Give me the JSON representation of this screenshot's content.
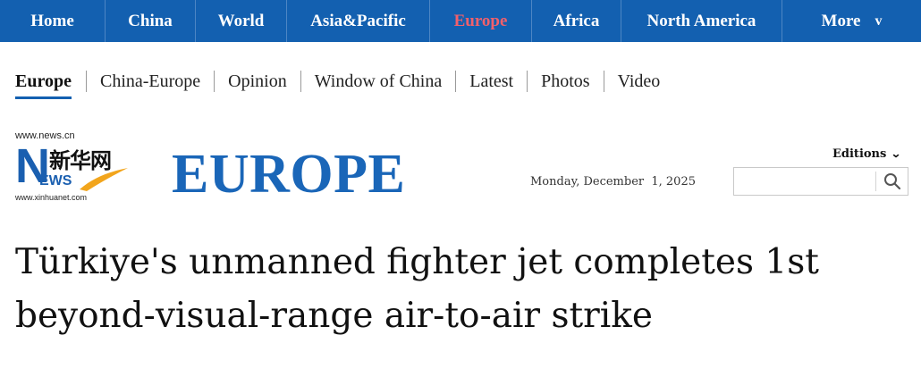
{
  "topnav": {
    "items": [
      {
        "label": "Home"
      },
      {
        "label": "China"
      },
      {
        "label": "World"
      },
      {
        "label": "Asia&Pacific"
      },
      {
        "label": "Europe",
        "active": true
      },
      {
        "label": "Africa"
      },
      {
        "label": "North America"
      },
      {
        "label": "More",
        "icon": "chevron-down-icon",
        "chevron": "v"
      }
    ],
    "bg_color": "#1360b0",
    "active_color": "#f2606b"
  },
  "subnav": {
    "items": [
      {
        "label": "Europe",
        "active": true
      },
      {
        "label": "China-Europe"
      },
      {
        "label": "Opinion"
      },
      {
        "label": "Window of China"
      },
      {
        "label": "Latest"
      },
      {
        "label": "Photos"
      },
      {
        "label": "Video"
      }
    ]
  },
  "logo": {
    "url_top": "www.news.cn",
    "letter": "N",
    "chinese": "新华网",
    "ews": "EWS",
    "url_bottom": "www.xinhuanet.com",
    "brand_color": "#1a5fb0",
    "swoosh_color": "#f2a51c"
  },
  "section_title": "EUROPE",
  "date": "Monday, December  1, 2025",
  "editions": {
    "label": "Editions",
    "icon": "chevron-down-icon"
  },
  "search": {
    "placeholder": "",
    "value": "",
    "icon": "search-icon"
  },
  "headline": "Türkiye's unmanned fighter jet completes 1st beyond-visual-range air-to-air strike"
}
